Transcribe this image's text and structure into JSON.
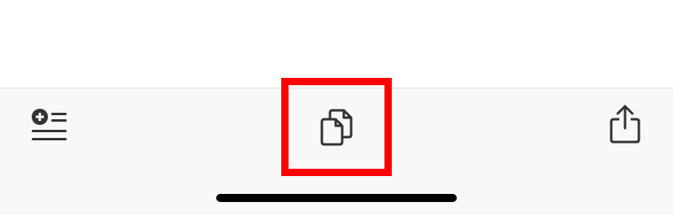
{
  "toolbar": {
    "buttons": [
      {
        "icon": "add-to-reading-list-icon"
      },
      {
        "icon": "copy-pages-icon"
      },
      {
        "icon": "share-icon"
      }
    ]
  },
  "highlight": {
    "color": "#ff0000",
    "target": "copy-pages-icon"
  },
  "colors": {
    "icon": "#333333",
    "toolbar_bg": "#f8f8f8",
    "home_indicator": "#000000"
  }
}
